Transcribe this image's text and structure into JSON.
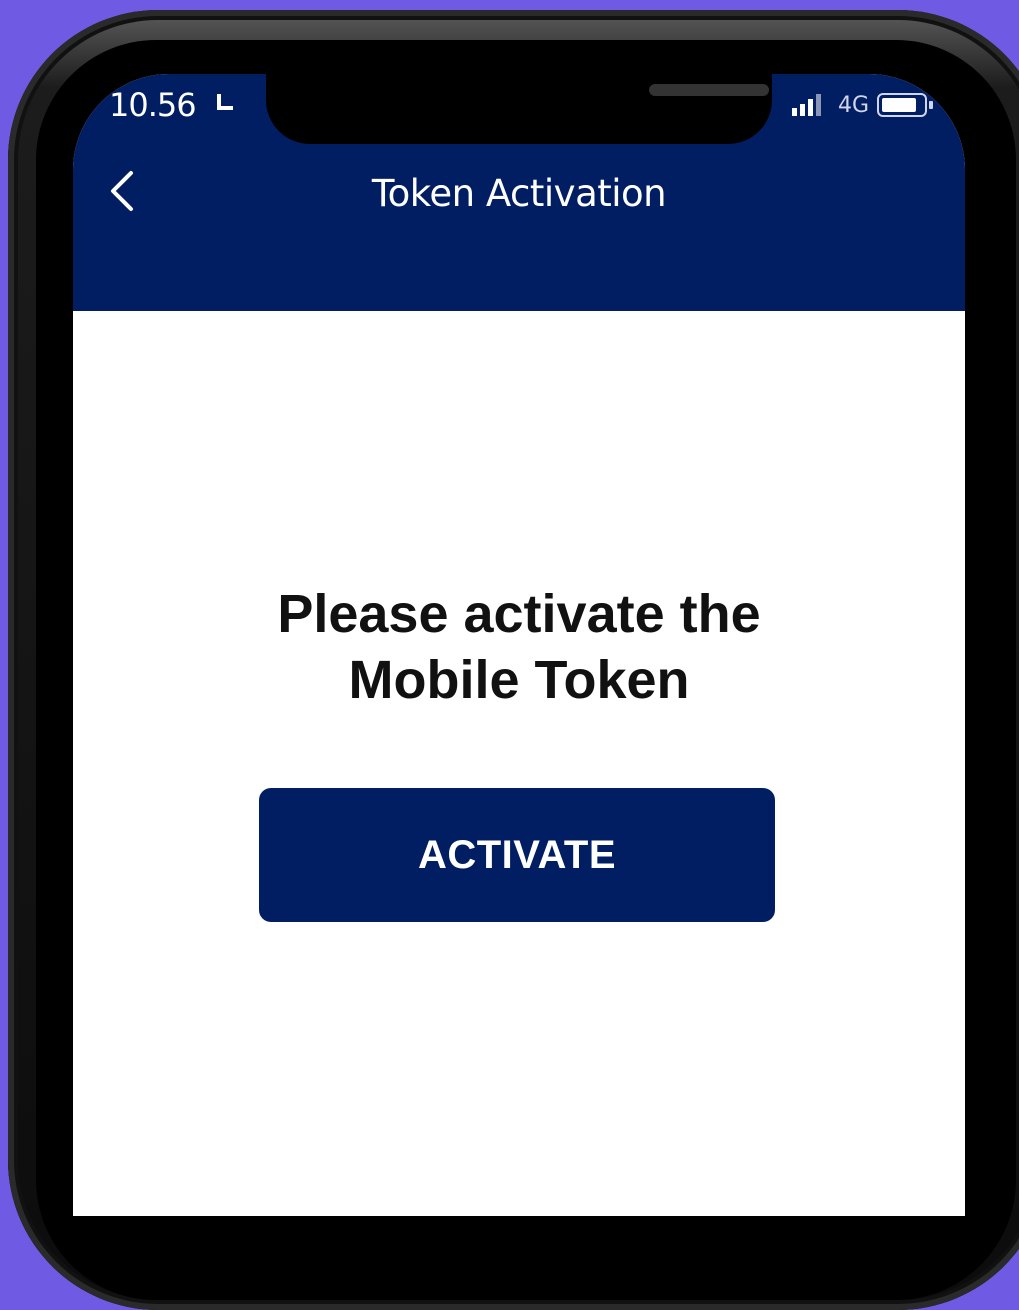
{
  "status_bar": {
    "time": "10.56",
    "network": "4G",
    "icons": [
      "moon-icon",
      "signal-icon",
      "battery-icon"
    ]
  },
  "header": {
    "title": "Token Activation",
    "back_icon": "chevron-left-icon"
  },
  "main": {
    "prompt": "Please activate the Mobile Token",
    "activate_label": "ACTIVATE"
  },
  "colors": {
    "background": "#6f5be3",
    "brand_navy": "#021e63",
    "text_dark": "#111111",
    "white": "#ffffff"
  }
}
